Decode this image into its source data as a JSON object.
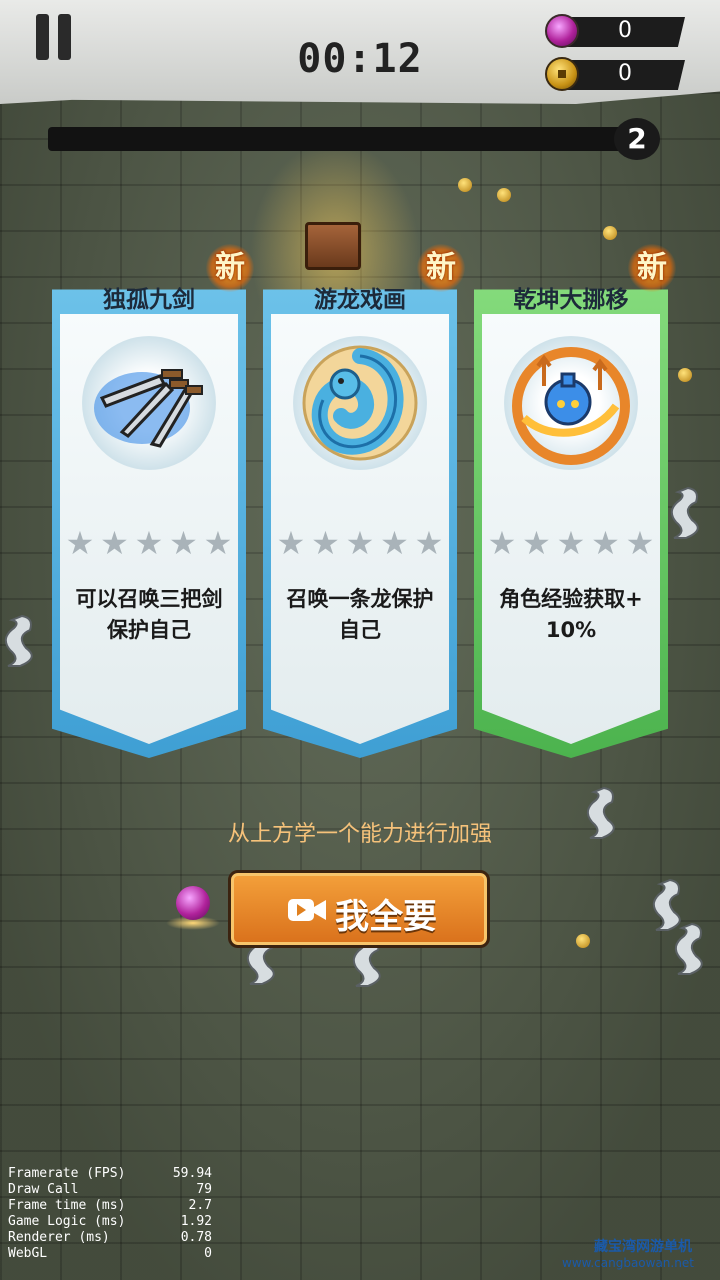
{
  "hud": {
    "timer": "00:12",
    "gems": "0",
    "coins": "0",
    "level": "2",
    "xp_progress": 0.0
  },
  "cards": [
    {
      "title": "独孤九剑",
      "badge": "新",
      "icon": "three-swords-icon",
      "stars_total": 5,
      "stars_filled": 0,
      "desc_lines": [
        "可以召唤三把剑",
        "保护自己"
      ]
    },
    {
      "title": "游龙戏画",
      "badge": "新",
      "icon": "blue-dragon-icon",
      "stars_total": 5,
      "stars_filled": 0,
      "desc_lines": [
        "召唤一条龙保护",
        "自己"
      ]
    },
    {
      "title": "乾坤大挪移",
      "badge": "新",
      "icon": "blue-flask-fire-icon",
      "stars_total": 5,
      "stars_filled": 0,
      "desc_lines": [
        "角色经验获取+",
        "10%"
      ]
    }
  ],
  "hint": "从上方学一个能力进行加强",
  "take_all_button": {
    "label": "我全要",
    "icon": "video-camera-icon"
  },
  "stats": [
    {
      "label": "Framerate (FPS)",
      "value": "59.94"
    },
    {
      "label": "Draw Call",
      "value": "79"
    },
    {
      "label": "Frame time (ms)",
      "value": "2.7"
    },
    {
      "label": "Game Logic (ms)",
      "value": "1.92"
    },
    {
      "label": "Renderer (ms)",
      "value": "0.78"
    },
    {
      "label": "WebGL",
      "value": "0"
    }
  ],
  "watermark": {
    "line1": "藏宝湾网游单机",
    "line2": "www.cangbaowan.net"
  },
  "colors": {
    "card_blue": "#5bb4e2",
    "card_green": "#6ccb64",
    "button_orange": "#e8861f",
    "hint_text": "#f6c27a"
  }
}
